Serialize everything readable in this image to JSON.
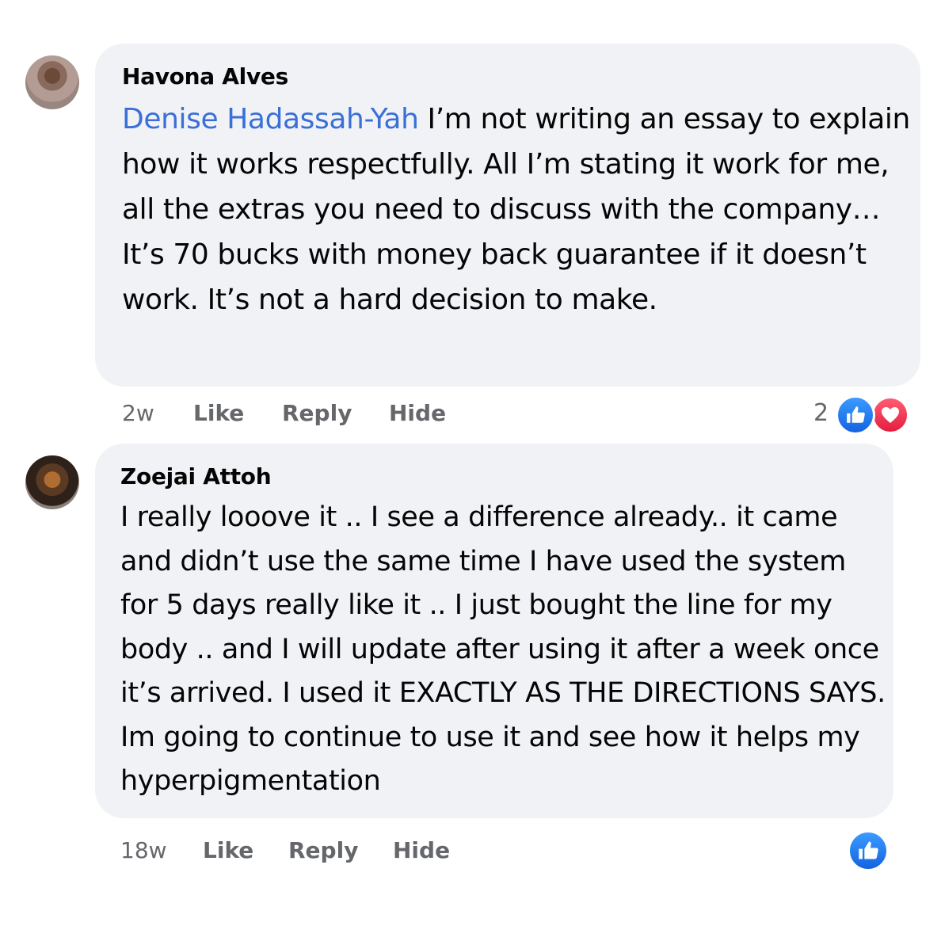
{
  "comments": [
    {
      "author": "Havona Alves",
      "mention": "Denise Hadassah-Yah",
      "text": " I’m not writing an essay to explain how it works respectfully. All I’m stating it work for me, all the extras you need to discuss with the company… It’s 70 bucks with money back guarantee if it doesn’t work. It’s not a hard decision to make.",
      "time": "2w",
      "like_label": "Like",
      "reply_label": "Reply",
      "hide_label": "Hide",
      "reaction_count": "2",
      "reactions": [
        "like-icon",
        "love-icon"
      ]
    },
    {
      "author": "Zoejai Attoh",
      "text": "I really looove it .. I see a difference already.. it came and didn’t use the same time I have used the system for 5 days really like it .. I just bought the line for my body .. and I will update after using it after a week once it’s arrived. I used it EXACTLY AS THE DIRECTIONS SAYS. Im going to continue to use it and see how it helps my hyperpigmentation",
      "time": "18w",
      "like_label": "Like",
      "reply_label": "Reply",
      "hide_label": "Hide",
      "reactions": [
        "like-icon"
      ]
    }
  ],
  "colors": {
    "bubble": "#f0f2f5",
    "mention": "#3a6fd8",
    "like_blue": "#1877f2",
    "love_red": "#e41e3f",
    "meta_gray": "#65676b"
  }
}
